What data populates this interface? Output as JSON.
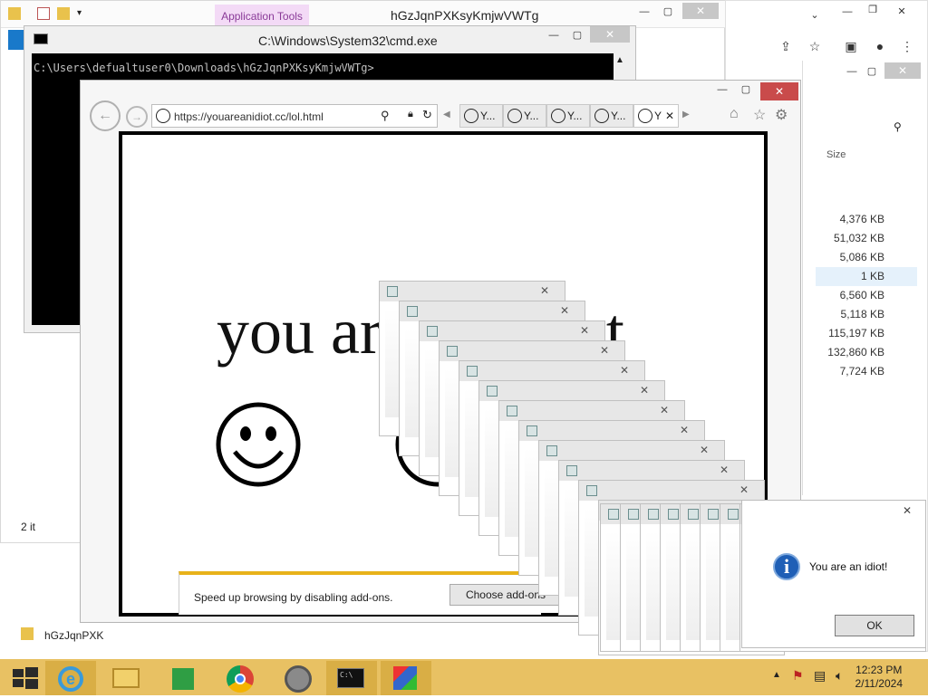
{
  "explorer": {
    "app_tools": "Application Tools",
    "title": "hGzJqnPXKsyKmjwVWTg",
    "status_items": "2 it",
    "address_path": "hGzJqnPXK"
  },
  "cmd": {
    "title": "C:\\Windows\\System32\\cmd.exe",
    "prompt": "C:\\Users\\defualtuser0\\Downloads\\hGzJqnPXKsyKmjwVWTg>"
  },
  "ie": {
    "url": "https://youareanidiot.cc/lol.html",
    "tabs": [
      "Y...",
      "Y...",
      "Y...",
      "Y...",
      "Y"
    ],
    "page_text": "you are an idiot",
    "notification": "Speed up browsing by disabling add-ons.",
    "choose_addons": "Choose add-ons"
  },
  "explorer_right": {
    "size_header": "Size",
    "sizes": [
      "4,376 KB",
      "51,032 KB",
      "5,086 KB",
      "1 KB",
      "6,560 KB",
      "5,118 KB",
      "115,197 KB",
      "132,860 KB",
      "7,724 KB"
    ]
  },
  "message_box": {
    "text": "You are an idiot!",
    "ok": "OK"
  },
  "taskbar": {
    "time": "12:23 PM",
    "date": "2/11/2024"
  },
  "colors": {
    "taskbar": "#e8c163",
    "ie_close": "#c94b4b",
    "notify_bar": "#e8b21a"
  }
}
